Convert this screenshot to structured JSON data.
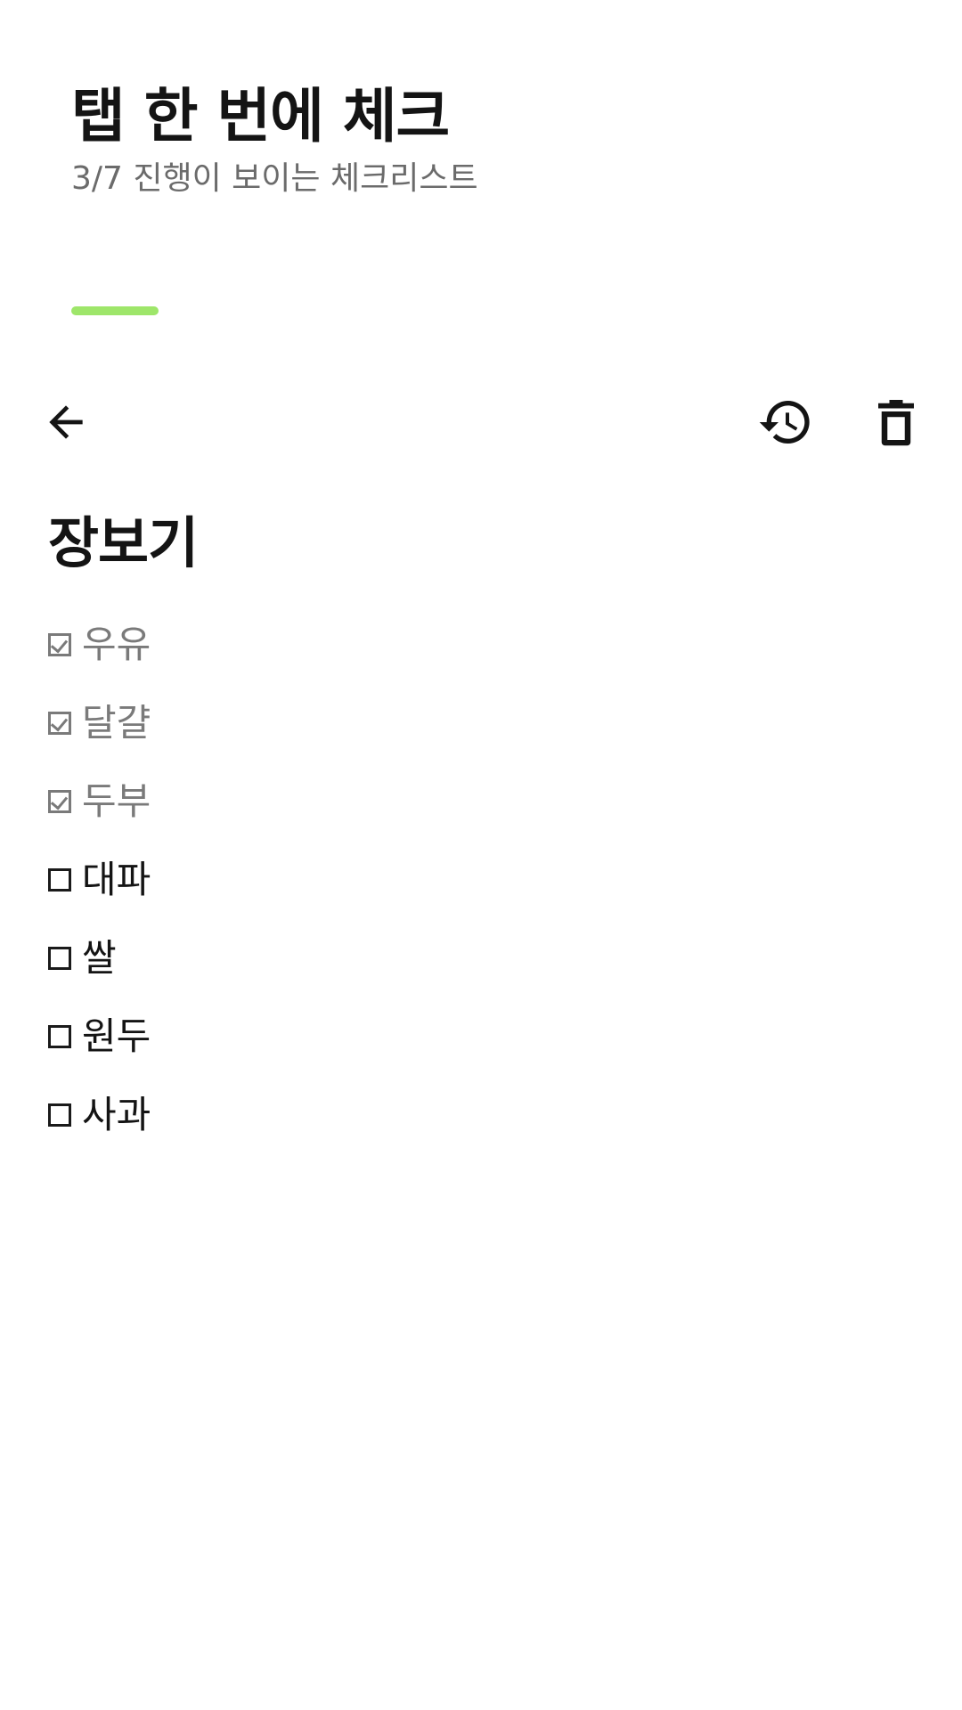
{
  "header": {
    "title": "탭 한 번에 체크",
    "subtitle": "3/7 진행이 보이는 체크리스트"
  },
  "colors": {
    "accent": "#9ee66a",
    "text": "#141414",
    "muted": "#7a7a7a",
    "background": "#ffffff"
  },
  "toolbar": {
    "back_icon": "arrow-back-icon",
    "history_icon": "history-icon",
    "delete_icon": "trash-icon"
  },
  "list": {
    "title": "장보기",
    "progress": {
      "done": 3,
      "total": 7
    },
    "items": [
      {
        "label": "우유",
        "checked": true
      },
      {
        "label": "달걀",
        "checked": true
      },
      {
        "label": "두부",
        "checked": true
      },
      {
        "label": "대파",
        "checked": false
      },
      {
        "label": "쌀",
        "checked": false
      },
      {
        "label": "원두",
        "checked": false
      },
      {
        "label": "사과",
        "checked": false
      }
    ]
  }
}
